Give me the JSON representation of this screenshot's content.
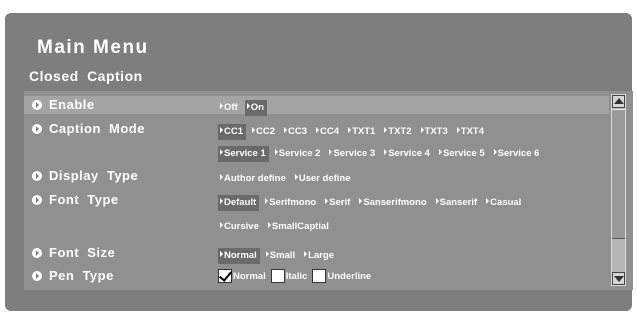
{
  "menu": {
    "title": "Main Menu",
    "subtitle": "Closed Caption"
  },
  "rows": {
    "enable": {
      "label": "Enable",
      "options": [
        "Off",
        "On"
      ],
      "selected": "On"
    },
    "caption_mode": {
      "label": "Caption Mode",
      "options_line1": [
        "CC1",
        "CC2",
        "CC3",
        "CC4",
        "TXT1",
        "TXT2",
        "TXT3",
        "TXT4"
      ],
      "options_line2": [
        "Service 1",
        "Service 2",
        "Service 3",
        "Service 4",
        "Service 5",
        "Service 6"
      ],
      "selected": "CC1 / Service 1"
    },
    "display_type": {
      "label": "Display Type",
      "options": [
        "Author define",
        "User define"
      ]
    },
    "font_type": {
      "label": "Font Type",
      "options_line1": [
        "Default",
        "Serifmono",
        "Serif",
        "Sanserifmono",
        "Sanserif",
        "Casual"
      ],
      "options_line2": [
        "Cursive",
        "SmallCaptial"
      ],
      "selected": "Default"
    },
    "font_size": {
      "label": "Font Size",
      "options": [
        "Normal",
        "Small",
        "Large"
      ],
      "selected": "Normal"
    },
    "pen_type": {
      "label": "Pen Type",
      "options": [
        {
          "label": "Normal",
          "checked": true
        },
        {
          "label": "Italic",
          "checked": false
        },
        {
          "label": "Underline",
          "checked": false
        }
      ]
    }
  },
  "icons": {
    "row_bullet": "circle-arrow-right-icon",
    "scroll_up": "triangle-up-icon",
    "scroll_down": "triangle-down-icon"
  },
  "colors": {
    "panel": "#7e7e7e",
    "content": "#909090",
    "selected_row": "#a4a4a4",
    "selected_option": "#6a6a6a",
    "text": "#ffffff"
  }
}
